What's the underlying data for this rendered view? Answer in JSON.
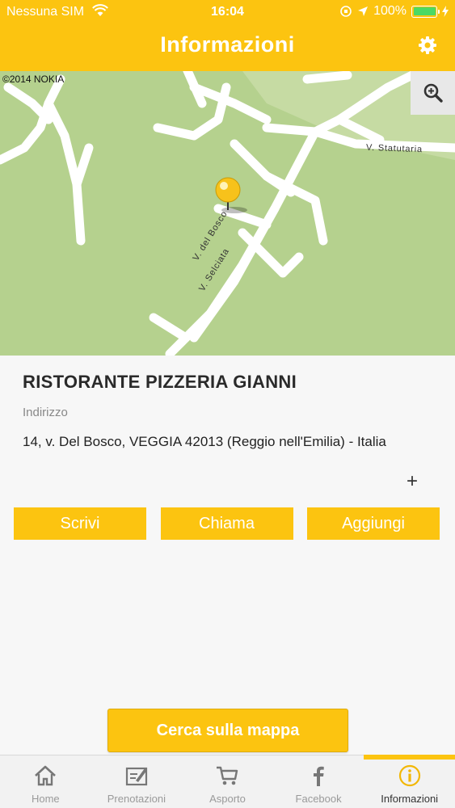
{
  "status_bar": {
    "carrier": "Nessuna SIM",
    "time": "16:04",
    "battery": "100%"
  },
  "header": {
    "title": "Informazioni",
    "settings_icon": "gear-icon",
    "color": "#fcc410"
  },
  "map": {
    "credit": "©2014 NOKIA",
    "zoom_icon": "magnifier-plus-icon",
    "streets": {
      "statutaria": "V. Statutaria",
      "del_bosco": "V. del Bosco",
      "selciata": "V. Selciata"
    },
    "marker_icon": "map-pin-icon"
  },
  "info": {
    "name": "RISTORANTE PIZZERIA GIANNI",
    "address_label": "Indirizzo",
    "address": "14, v. Del Bosco, VEGGIA 42013 (Reggio nell'Emilia) - Italia",
    "more": "+"
  },
  "actions": {
    "write": "Scrivi",
    "call": "Chiama",
    "add": "Aggiungi"
  },
  "search_map": "Cerca sulla mappa",
  "tabs": [
    {
      "label": "Home",
      "icon": "home-icon"
    },
    {
      "label": "Prenotazioni",
      "icon": "booking-icon"
    },
    {
      "label": "Asporto",
      "icon": "cart-icon"
    },
    {
      "label": "Facebook",
      "icon": "facebook-icon"
    },
    {
      "label": "Informazioni",
      "icon": "info-icon",
      "active": true
    }
  ]
}
